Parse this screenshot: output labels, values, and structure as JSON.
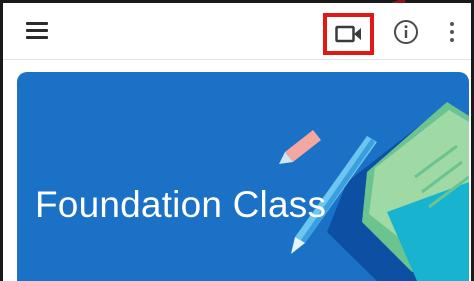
{
  "appbar": {
    "icons": {
      "menu": "hamburger-menu-icon",
      "video": "video-camera-icon",
      "info": "info-icon",
      "more": "more-vertical-icon"
    },
    "highlight_color": "#e01818"
  },
  "banner": {
    "title": "Foundation Class",
    "background_color": "#1a71c5"
  }
}
